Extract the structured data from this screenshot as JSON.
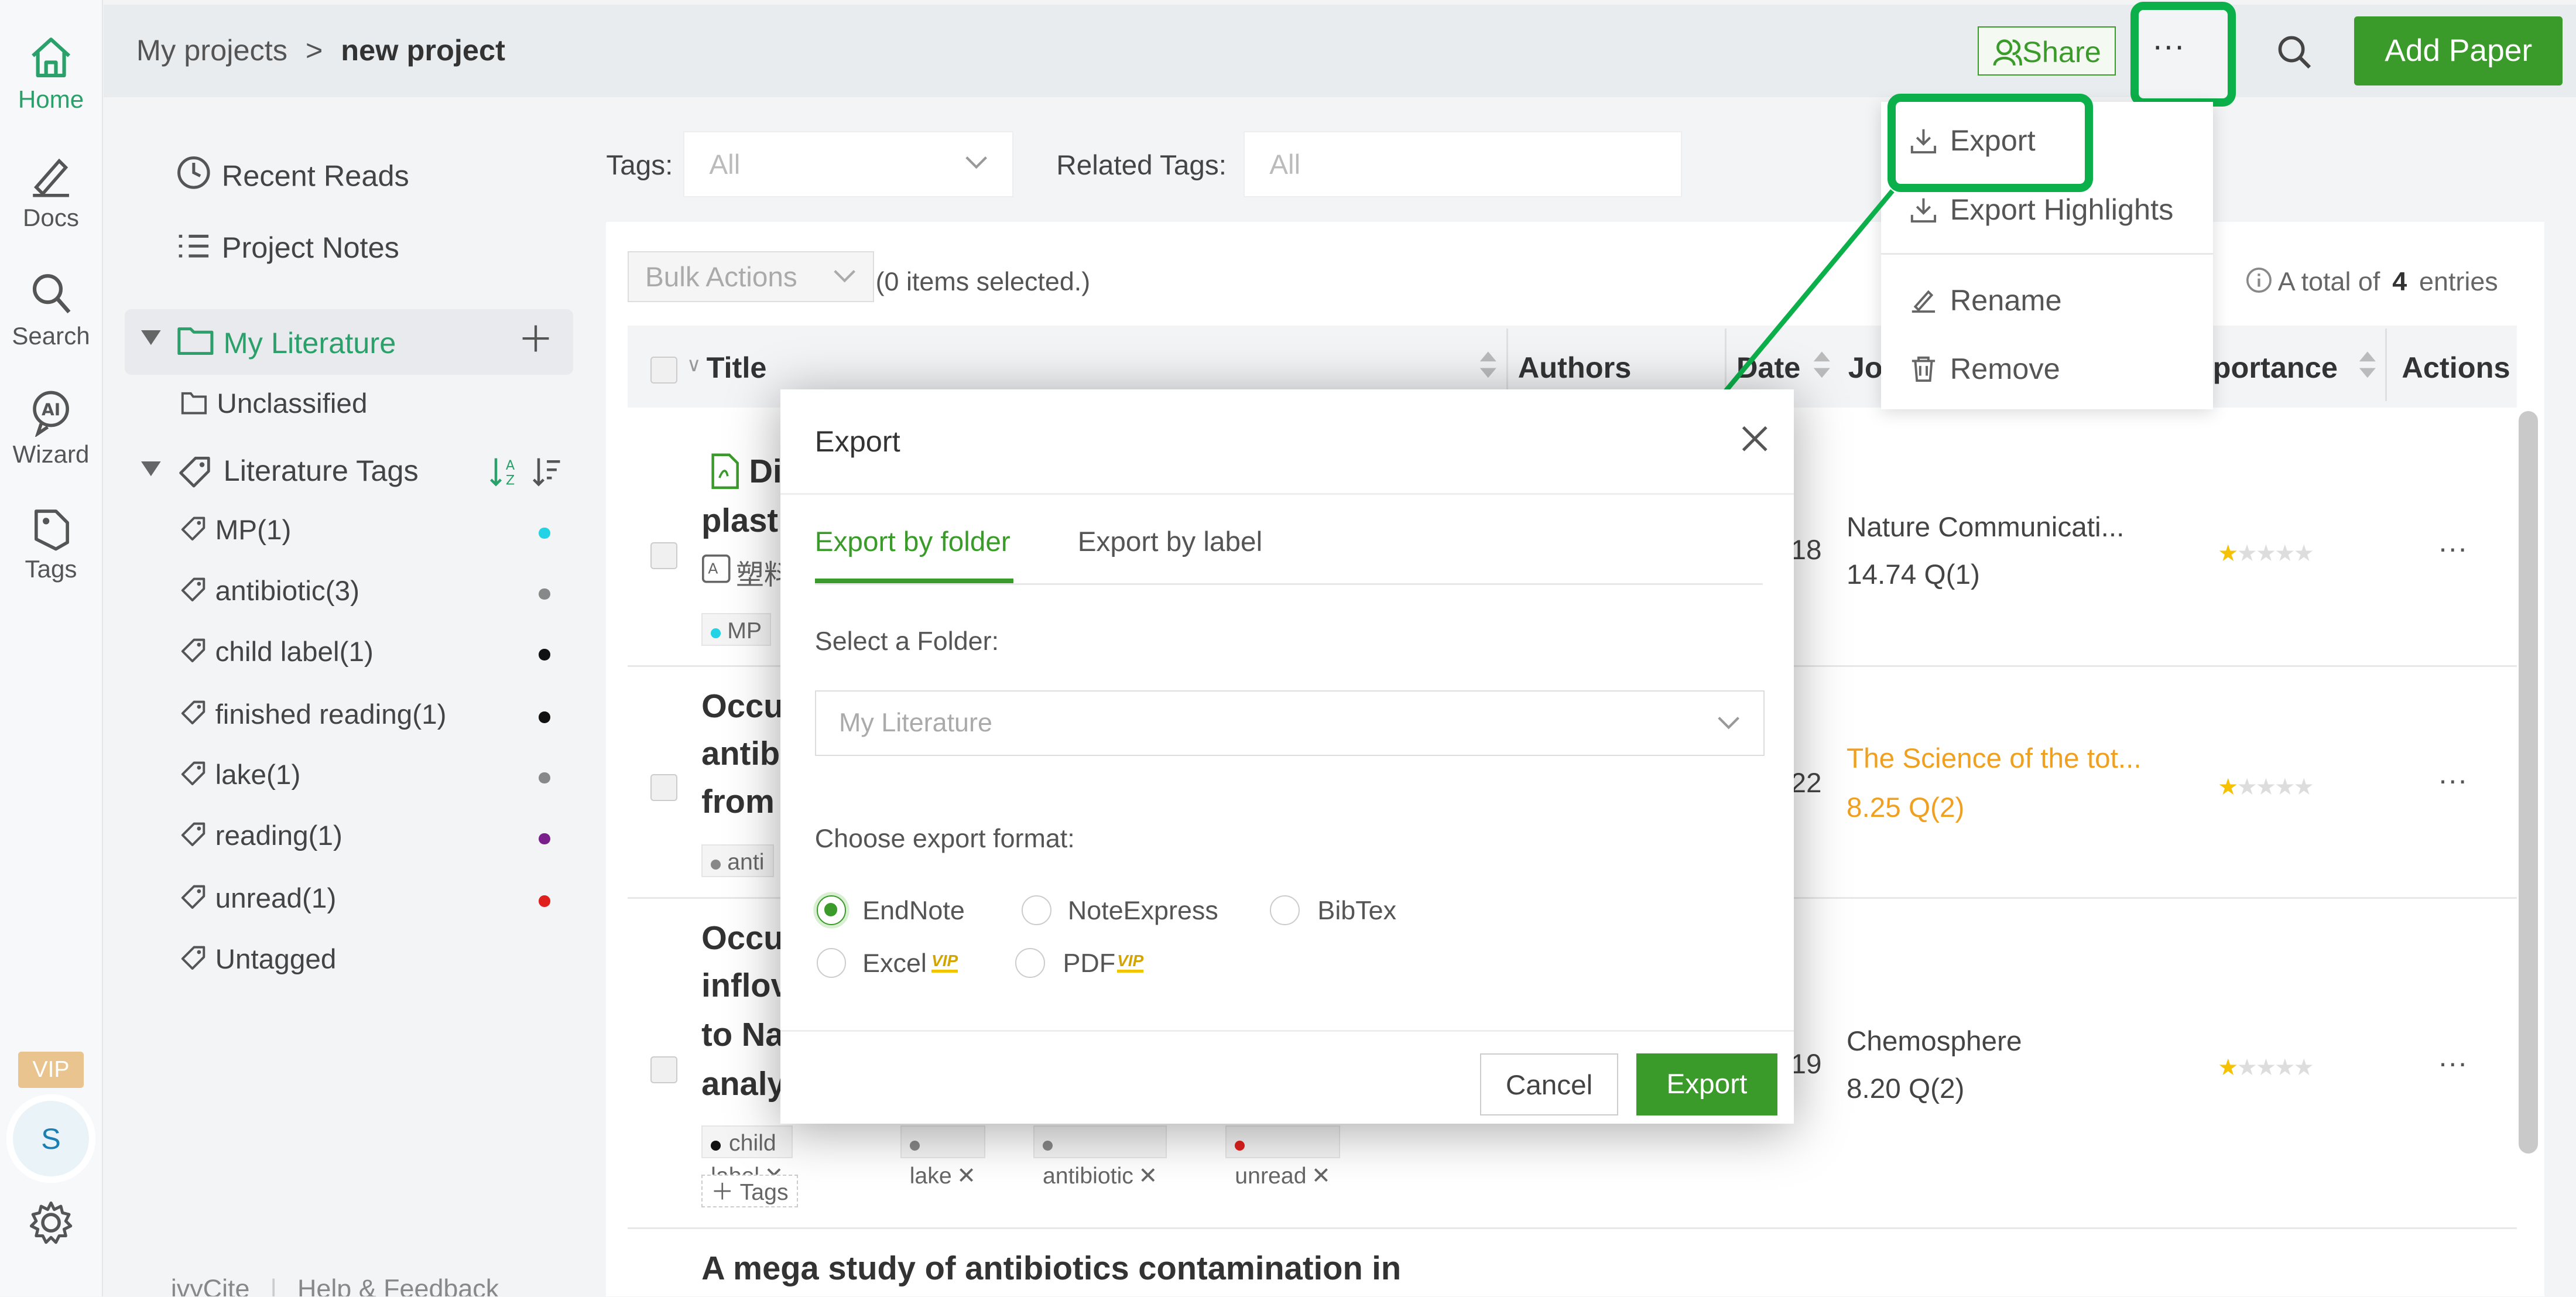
{
  "rail": {
    "home": "Home",
    "docs": "Docs",
    "search": "Search",
    "wizard": "Wizard",
    "tags": "Tags",
    "vip": "VIP",
    "avatar_letter": "S"
  },
  "breadcrumb": {
    "root": "My projects",
    "sep": ">",
    "current": "new project"
  },
  "topbar": {
    "share": "Share",
    "more": "···",
    "add_paper": "Add Paper"
  },
  "sidebar": {
    "recent_reads": "Recent Reads",
    "project_notes": "Project Notes",
    "my_literature": "My Literature",
    "unclassified": "Unclassified",
    "literature_tags": "Literature Tags",
    "tags": [
      {
        "label": "MP(1)",
        "color": "#22d3e6"
      },
      {
        "label": "antibiotic(3)",
        "color": "#888888"
      },
      {
        "label": "child label(1)",
        "color": "#111111"
      },
      {
        "label": "finished reading(1)",
        "color": "#111111"
      },
      {
        "label": "lake(1)",
        "color": "#888888"
      },
      {
        "label": "reading(1)",
        "color": "#7a1f8c"
      },
      {
        "label": "unread(1)",
        "color": "#e0201c"
      },
      {
        "label": "Untagged",
        "color": ""
      }
    ],
    "footer_brand": "ivyCite",
    "footer_sep": "|",
    "footer_help": "Help & Feedback"
  },
  "filters": {
    "tags_label": "Tags:",
    "tags_value": "All",
    "related_label": "Related Tags:",
    "related_value": "All"
  },
  "table": {
    "bulk_actions": "Bulk Actions",
    "selected_info": "(0 items selected.)",
    "total_prefix": "A total of",
    "total_count": "4",
    "total_suffix": "entries",
    "headers": {
      "title": "Title",
      "authors": "Authors",
      "date": "Date",
      "journal": "Jo",
      "importance": "portance",
      "actions": "Actions"
    },
    "rows": [
      {
        "title1": "Di",
        "title2": "plasti",
        "title3": "塑料",
        "date": "18",
        "journal": "Nature Communicati...",
        "impact": "14.74 Q(1)",
        "chip": "MP"
      },
      {
        "title1": "Occu",
        "title2": "antib",
        "title3": "from",
        "date": "22",
        "journal": "The Science of the tot...",
        "impact": "8.25 Q(2)",
        "chip": "anti"
      },
      {
        "title1": "Occu",
        "title2": "inflov",
        "title3": "to Na",
        "title4": "analy",
        "date": "19",
        "journal": "Chemosphere",
        "impact": "8.20 Q(2)"
      }
    ],
    "row3_chips": [
      "child label",
      "lake",
      "antibiotic",
      "unread"
    ],
    "add_tags": "Tags",
    "row4_title": "A mega study of antibiotics contamination in",
    "row_more": "···"
  },
  "dropdown": {
    "export": "Export",
    "export_highlights": "Export Highlights",
    "rename": "Rename",
    "remove": "Remove"
  },
  "modal": {
    "title": "Export",
    "tab_folder": "Export by folder",
    "tab_label": "Export by label",
    "select_folder_label": "Select a Folder:",
    "folder_value": "My Literature",
    "format_label": "Choose export format:",
    "formats": [
      "EndNote",
      "NoteExpress",
      "BibTex",
      "Excel",
      "PDF"
    ],
    "vip": "VIP",
    "cancel": "Cancel",
    "export": "Export"
  },
  "colors": {
    "accent": "#3a9b2a",
    "highlight": "#0cb04a",
    "journal_orange": "#f0a020"
  }
}
